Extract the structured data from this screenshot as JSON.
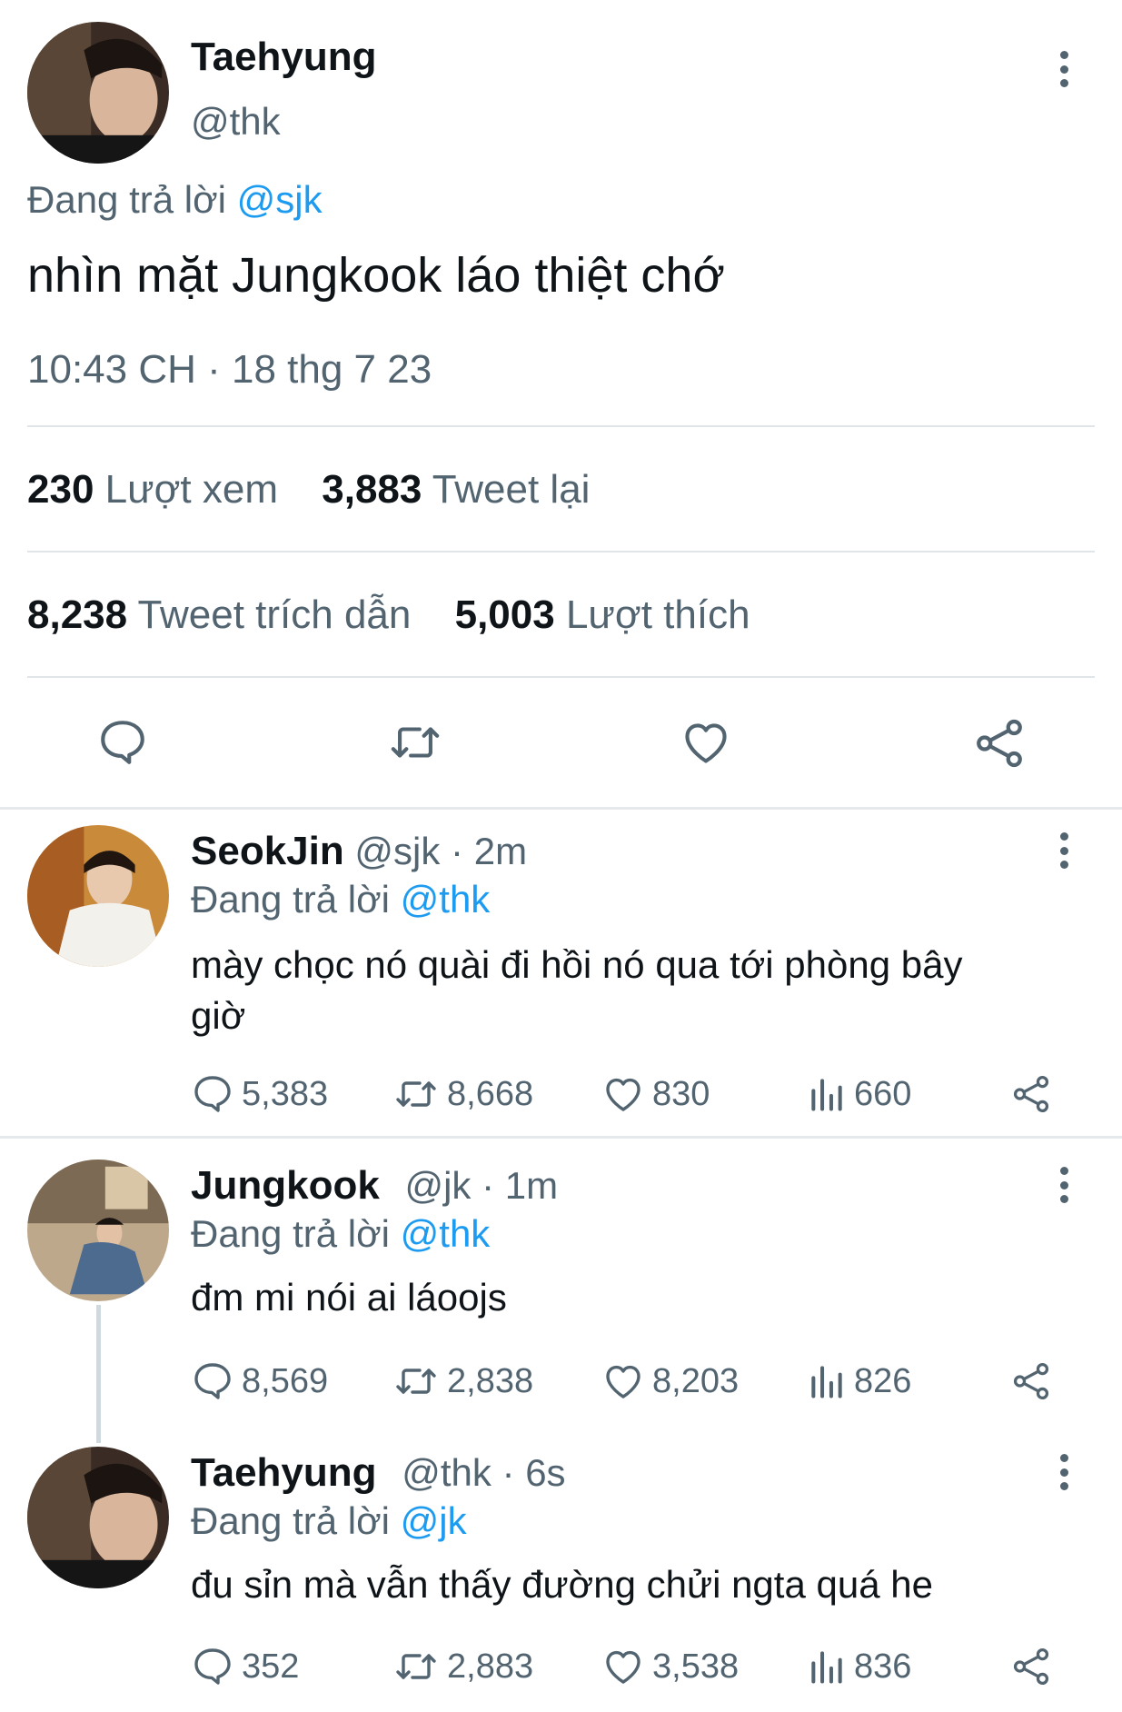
{
  "main_tweet": {
    "display_name": "Taehyung",
    "handle": "@thk",
    "reply_prefix": "Đang trả lời",
    "reply_to": "@sjk",
    "text": "nhìn mặt Jungkook láo thiệt chớ",
    "timestamp": "10:43 CH · 18 thg 7 23",
    "stats": {
      "views_count": "230",
      "views_label": "Lượt xem",
      "retweets_count": "3,883",
      "retweets_label": "Tweet lại",
      "quotes_count": "8,238",
      "quotes_label": "Tweet trích dẫn",
      "likes_count": "5,003",
      "likes_label": "Lượt thích"
    }
  },
  "replies": [
    {
      "display_name": "SeokJin",
      "handle_time": "@sjk · 2m",
      "reply_prefix": "Đang trả lời",
      "reply_to": "@thk",
      "text_line1": "mày chọc nó quài đi hồi nó qua tới phòng bây",
      "text_line2": "giờ",
      "replies": "5,383",
      "retweets": "8,668",
      "likes": "830",
      "views": "660"
    },
    {
      "display_name": "Jungkook",
      "handle_time": "@jk · 1m",
      "reply_prefix": "Đang trả lời",
      "reply_to": "@thk",
      "text_line1": "đm mi nói ai láoojs",
      "replies": "8,569",
      "retweets": "2,838",
      "likes": "8,203",
      "views": "826"
    },
    {
      "display_name": "Taehyung",
      "handle_time": "@thk · 6s",
      "reply_prefix": "Đang trả lời",
      "reply_to": "@jk",
      "text_line1": "đu sỉn mà vẫn thấy đường chửi ngta quá he",
      "replies": "352",
      "retweets": "2,883",
      "likes": "3,538",
      "views": "836"
    }
  ],
  "colors": {
    "accent": "#1d9bf0",
    "secondary_text": "#536471",
    "primary_text": "#0f1419"
  },
  "icons": [
    "reply-icon",
    "retweet-icon",
    "like-icon",
    "share-icon",
    "views-icon",
    "more-icon"
  ]
}
